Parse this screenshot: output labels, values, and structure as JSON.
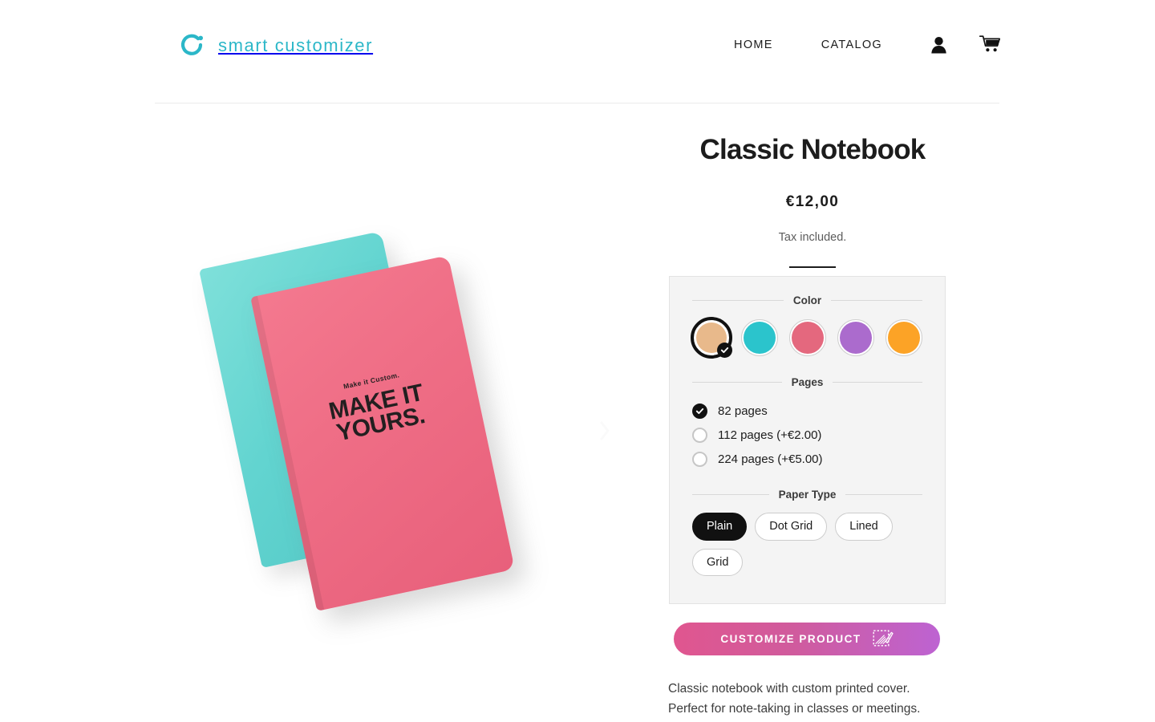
{
  "header": {
    "logo_text": "smart customizer",
    "logo_icon": "ring-dot-logo-icon",
    "nav_links": [
      {
        "label": "HOME"
      },
      {
        "label": "CATALOG"
      }
    ],
    "account_icon": "person-icon",
    "cart_icon": "shopping-cart-icon"
  },
  "gallery": {
    "front_notebook": {
      "kicker": "Make it Custom.",
      "headline_line1": "MAKE IT",
      "headline_line2": "YOURS.",
      "color": "#ef6e86"
    },
    "back_notebook": {
      "color": "#62d4d0"
    },
    "next_arrow_icon": "chevron-right-icon"
  },
  "product": {
    "title": "Classic Notebook",
    "price": "€12,00",
    "tax_note": "Tax included.",
    "description_line1": "Classic notebook with custom printed cover.",
    "description_line2": "Perfect for note-taking in classes or meetings."
  },
  "options": {
    "color": {
      "legend": "Color",
      "swatches": [
        {
          "name": "tan",
          "hex": "#e8b98b",
          "selected": true
        },
        {
          "name": "teal",
          "hex": "#2bc4cc",
          "selected": false
        },
        {
          "name": "pink",
          "hex": "#e4687e",
          "selected": false
        },
        {
          "name": "purple",
          "hex": "#ab6bcd",
          "selected": false
        },
        {
          "name": "orange",
          "hex": "#fca326",
          "selected": false
        }
      ],
      "check_icon": "check-icon"
    },
    "pages": {
      "legend": "Pages",
      "choices": [
        {
          "label": "82 pages",
          "selected": true
        },
        {
          "label": "112 pages (+€2.00)",
          "selected": false
        },
        {
          "label": "224 pages (+€5.00)",
          "selected": false
        }
      ]
    },
    "paper_type": {
      "legend": "Paper Type",
      "choices": [
        {
          "label": "Plain",
          "selected": true
        },
        {
          "label": "Dot Grid",
          "selected": false
        },
        {
          "label": "Lined",
          "selected": false
        },
        {
          "label": "Grid",
          "selected": false
        }
      ]
    }
  },
  "cta": {
    "label": "CUSTOMIZE PRODUCT",
    "icon": "design-pencil-icon",
    "gradient_from": "#e0568f",
    "gradient_to": "#bd63d2"
  }
}
